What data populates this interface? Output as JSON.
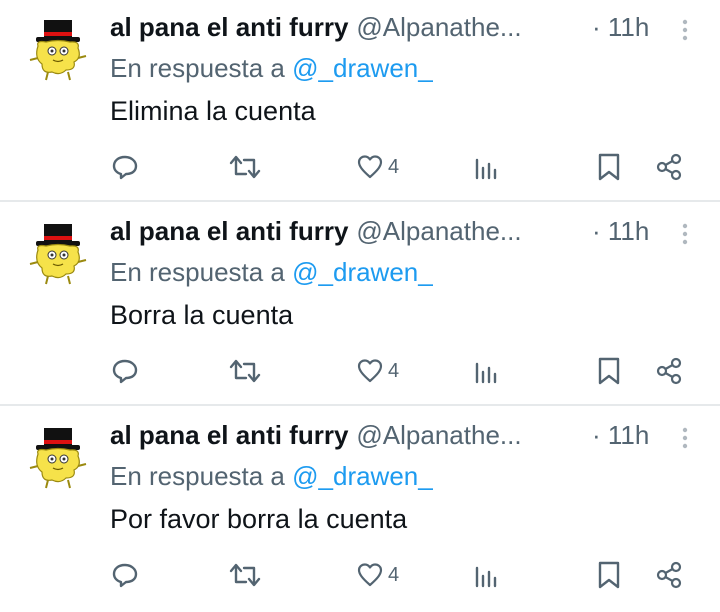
{
  "tweets": [
    {
      "name": "al pana el anti furry",
      "handle": "@Alpanathe...",
      "time": "· 11h",
      "reply_prefix": "En respuesta a",
      "reply_to": "@_drawen_",
      "text": "Elimina la cuenta",
      "likes": "4"
    },
    {
      "name": "al pana el anti furry",
      "handle": "@Alpanathe...",
      "time": "· 11h",
      "reply_prefix": "En respuesta a",
      "reply_to": "@_drawen_",
      "text": "Borra la cuenta",
      "likes": "4"
    },
    {
      "name": "al pana el anti furry",
      "handle": "@Alpanathe...",
      "time": "· 11h",
      "reply_prefix": "En respuesta a",
      "reply_to": "@_drawen_",
      "text": "Por favor borra la cuenta",
      "likes": "4"
    }
  ],
  "colors": {
    "text": "#0f1419",
    "secondary": "#536471",
    "mention": "#1d9bf0",
    "divider": "#e6e9eb"
  },
  "icons": {
    "reply": "reply-icon",
    "retweet": "retweet-icon",
    "like": "heart-icon",
    "views": "views-chart-icon",
    "bookmark": "bookmark-icon",
    "share": "share-icon",
    "more": "more-vertical-icon",
    "avatar": "avatar-tophat-creature"
  }
}
